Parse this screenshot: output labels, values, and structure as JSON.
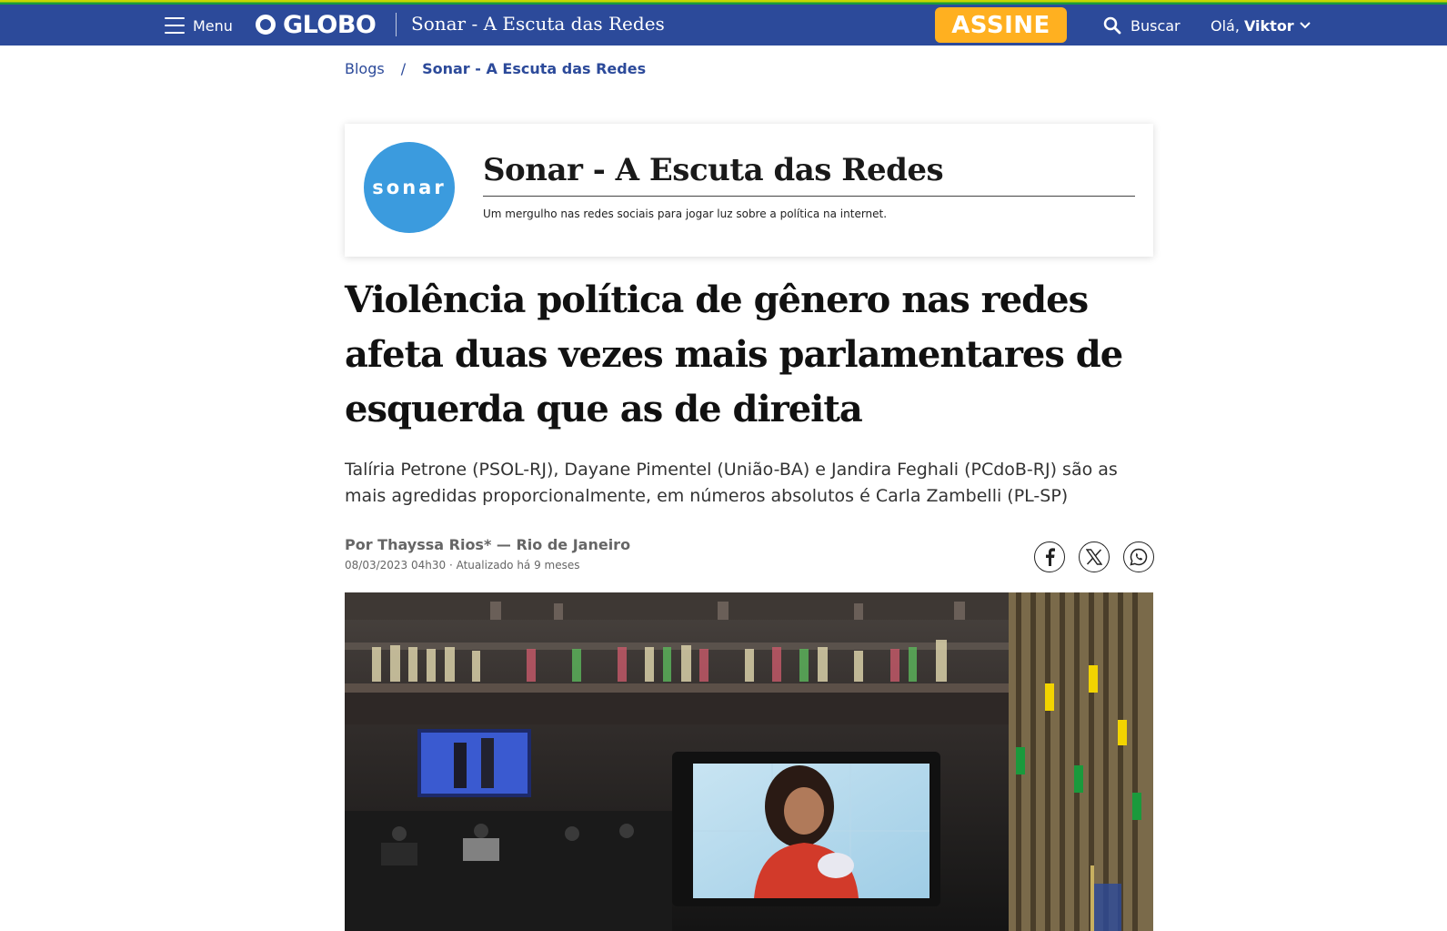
{
  "nav": {
    "menu_label": "Menu",
    "logo_text": "GLOBO",
    "blog_name": "Sonar - A Escuta das Redes",
    "subscribe_label": "ASSINE",
    "search_label": "Buscar",
    "greeting": "Olá,",
    "user_name": "Viktor"
  },
  "breadcrumb": {
    "parent": "Blogs",
    "separator": "/",
    "current": "Sonar - A Escuta das Redes"
  },
  "blog": {
    "avatar_text": "sonar",
    "title": "Sonar - A Escuta das Redes",
    "description": "Um mergulho nas redes sociais para jogar luz sobre a política na internet."
  },
  "article": {
    "headline": "Violência política de gênero nas redes afeta duas vezes mais parlamentares de esquerda que as de direita",
    "subheadline": "Talíria Petrone (PSOL-RJ), Dayane Pimentel (União-BA) e Jandira Feghali (PCdoB-RJ) são as mais agredidas proporcionalmente, em números absolutos é Carla Zambelli (PL-SP)",
    "byline": "Por Thayssa Rios* — Rio de Janeiro",
    "dateline": "08/03/2023 04h30 · Atualizado há 9 meses"
  },
  "share": {
    "facebook": "facebook-icon",
    "x": "x-icon",
    "whatsapp": "whatsapp-icon"
  },
  "colors": {
    "nav_bg": "#2c4a9a",
    "subscribe_bg": "#ffb020",
    "avatar_bg": "#3b9bde"
  }
}
